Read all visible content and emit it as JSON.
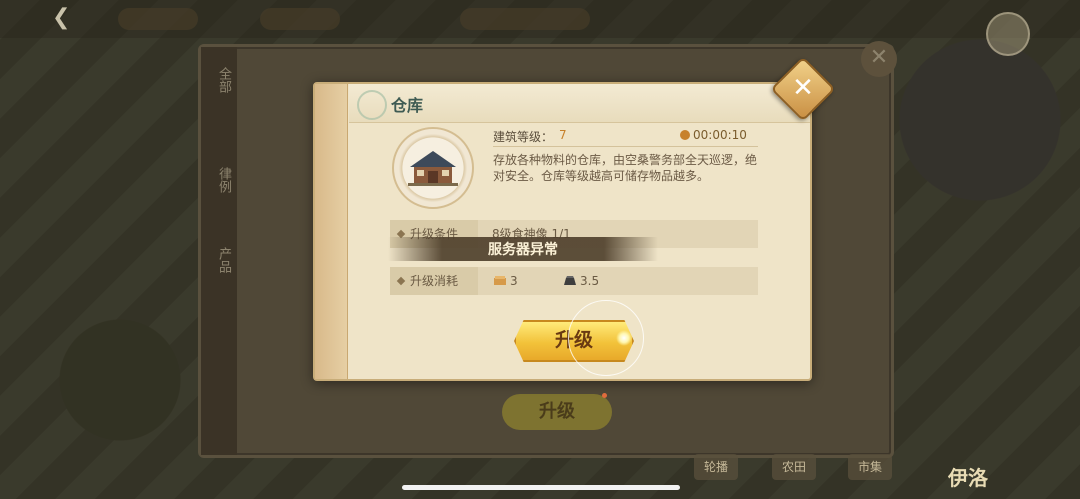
{
  "background": {
    "tags": [
      "轮播",
      "农田",
      "市集"
    ],
    "bottom_right_label": "伊洛",
    "base_panel": {
      "side_tabs": [
        "全部",
        "律例",
        "产品"
      ],
      "upgrade_label": "升级"
    }
  },
  "dialog": {
    "title": "仓库",
    "building_level_label": "建筑等级：",
    "building_level_value": "7",
    "timer": "00:00:10",
    "description": "存放各种物料的仓库，由空桑警务部全天巡逻，绝对安全。仓库等级越高可储存物品越多。",
    "requirement_label": "升级条件",
    "requirement_value": "8级食神像  1/1",
    "cost_label": "升级消耗",
    "costs": [
      {
        "icon": "wood-plank-icon",
        "amount": "3"
      },
      {
        "icon": "iron-ingot-icon",
        "amount": "3.5"
      }
    ],
    "upgrade_button": "升级",
    "close_icon": "close-icon"
  },
  "toast": {
    "message": "服务器异常"
  },
  "colors": {
    "dialog_bg": "#efe4c8",
    "button_gold": "#f2c23a",
    "accent_orange": "#c7812b",
    "title_green": "#3f5b53"
  }
}
